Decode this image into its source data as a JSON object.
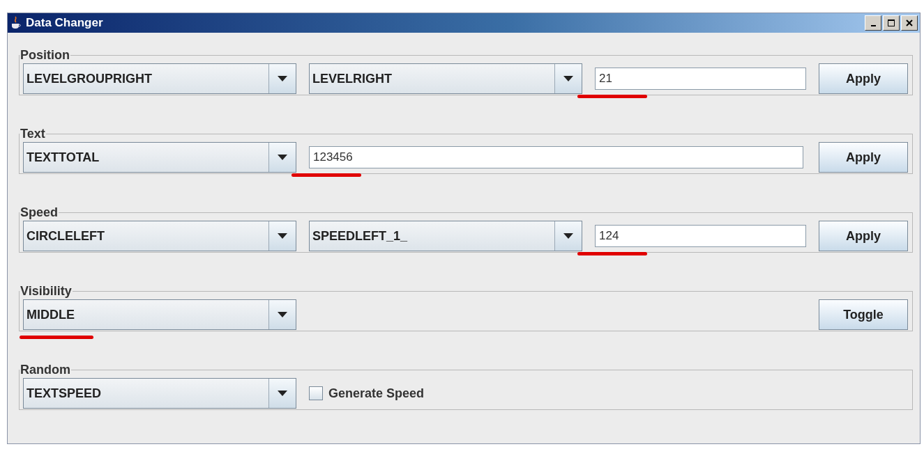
{
  "window": {
    "title": "Data Changer"
  },
  "groups": [
    {
      "title": "Position",
      "controls": [
        {
          "kind": "combo",
          "value": "LEVELGROUPRIGHT",
          "annotated": false
        },
        {
          "kind": "combo",
          "value": "LEVELRIGHT",
          "annotated": false
        },
        {
          "kind": "field",
          "value": "21",
          "annotated": true
        },
        {
          "kind": "button",
          "label": "Apply"
        }
      ]
    },
    {
      "title": "Text",
      "controls": [
        {
          "kind": "combo",
          "value": "TEXTTOTAL",
          "annotated": false
        },
        {
          "kind": "field",
          "value": "123456",
          "annotated": true
        },
        {
          "kind": "button",
          "label": "Apply"
        }
      ]
    },
    {
      "title": "Speed",
      "controls": [
        {
          "kind": "combo",
          "value": "CIRCLELEFT",
          "annotated": false
        },
        {
          "kind": "combo",
          "value": "SPEEDLEFT_1_",
          "annotated": false
        },
        {
          "kind": "field",
          "value": "124",
          "annotated": true
        },
        {
          "kind": "button",
          "label": "Apply"
        }
      ]
    },
    {
      "title": "Visibility",
      "controls": [
        {
          "kind": "combo",
          "value": "MIDDLE",
          "annotated": true
        },
        {
          "kind": "button",
          "label": "Toggle"
        }
      ]
    },
    {
      "title": "Random",
      "controls": [
        {
          "kind": "combo",
          "value": "TEXTSPEED",
          "annotated": false
        },
        {
          "kind": "checkbox",
          "label": "Generate Speed",
          "checked": false
        }
      ]
    }
  ]
}
